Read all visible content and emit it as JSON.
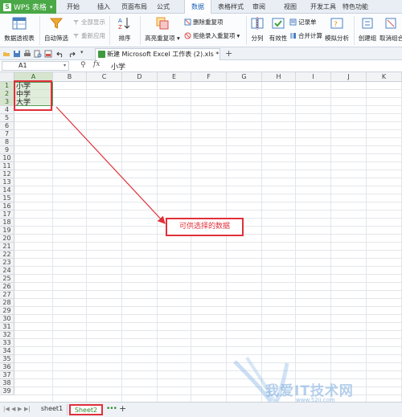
{
  "app": {
    "name": "WPS 表格"
  },
  "menu_tabs": [
    "开始",
    "插入",
    "页面布局",
    "公式",
    "数据",
    "表格样式",
    "审阅",
    "视图",
    "开发工具",
    "特色功能"
  ],
  "active_tab": "数据",
  "ribbon": {
    "pivot": "数据透视表",
    "autofilter": "自动筛选",
    "show_all": "全部显示",
    "reapply": "重新应用",
    "sort": "排序",
    "highlight_dup": "高亮重复项",
    "remove_dup": "删除重复项",
    "reject_dup": "拒绝录入重复项",
    "split": "分列",
    "validity": "有效性",
    "record": "记录单",
    "consolidate": "合并计算",
    "whatif": "模拟分析",
    "group": "创建组",
    "ungroup": "取消组合"
  },
  "document_tab": {
    "title": "新建 Microsoft Excel 工作表 (2).xls *"
  },
  "formula_bar": {
    "name_box": "A1",
    "fx": "fx",
    "content": "小学"
  },
  "columns": [
    "A",
    "B",
    "C",
    "D",
    "E",
    "F",
    "G",
    "H",
    "I",
    "J",
    "K"
  ],
  "rows": [
    "1",
    "2",
    "3",
    "4",
    "5",
    "6",
    "7",
    "8",
    "9",
    "10",
    "11",
    "12",
    "13",
    "14",
    "15",
    "16",
    "17",
    "18",
    "19",
    "20",
    "21",
    "22",
    "23",
    "24",
    "25",
    "26",
    "27",
    "28",
    "29",
    "30",
    "31",
    "32",
    "33",
    "34",
    "35",
    "36",
    "37",
    "38",
    "39"
  ],
  "cells": {
    "A1": "小学",
    "A2": "中学",
    "A3": "大学"
  },
  "annotation": {
    "callout": "可供选择的数据"
  },
  "sheets": [
    "sheet1",
    "Sheet2"
  ],
  "active_sheet": "Sheet2",
  "watermark": {
    "text": "我爱IT技术网",
    "url": "www.52ij.com"
  },
  "colors": {
    "accent": "#4aa846",
    "annotation_red": "#e0303a",
    "selection": "#d7e4ce"
  }
}
